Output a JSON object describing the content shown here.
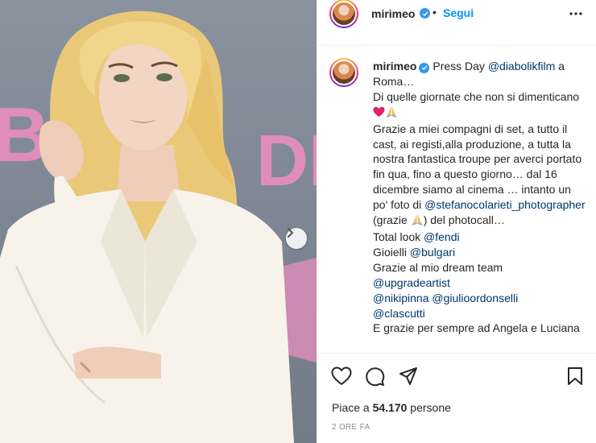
{
  "post": {
    "username": "mirimeo",
    "follow_label": "Segui",
    "dot": "•",
    "photo": {
      "backdrop_letters_left": "BC",
      "backdrop_letters_right": "DI"
    }
  },
  "caption": {
    "username": "mirimeo",
    "line1": " Press Day ",
    "mention_diabolik": "@diabolikfilm",
    "line1_end": " a Roma…",
    "line2": "Di quelle giornate che non si dimenticano ",
    "line3": "Grazie a miei compagni di set, a tutto il cast, ai registi,alla produzione, a tutta la nostra fantastica troupe per averci portato fin qua, fino a questo giorno… dal 16 dicembre siamo al cinema … intanto un po' foto di ",
    "mention_photographer": "@stefanocolarieti_photographer",
    "line3_end": " (grazie ",
    "line3_tail": ") del photocall…",
    "total_look": "Total look ",
    "mention_fendi": "@fendi",
    "gioielli": "Gioielli ",
    "mention_bulgari": "@bulgari",
    "dream_team": "Grazie al mio dream team",
    "mention_upgrade": "@upgradeartist",
    "mention_nikipinna": "@nikipinna",
    "space": " ",
    "mention_giulio": "@giulioordonselli",
    "mention_clascutti": "@clascutti",
    "last_line": "E grazie per sempre ad Angela e Luciana"
  },
  "footer": {
    "likes_prefix": "Piace a ",
    "likes_count": "54.170",
    "likes_suffix": " persone",
    "timestamp": "2 ORE FA"
  },
  "icons": [
    "heart-icon",
    "comment-icon",
    "share-icon",
    "bookmark-icon",
    "more-icon",
    "verified-icon",
    "chevron-right-icon"
  ],
  "colors": {
    "link": "#00376b",
    "follow": "#0095f6",
    "verified": "#3897f0",
    "backdrop_pink": "#f08fc0"
  }
}
